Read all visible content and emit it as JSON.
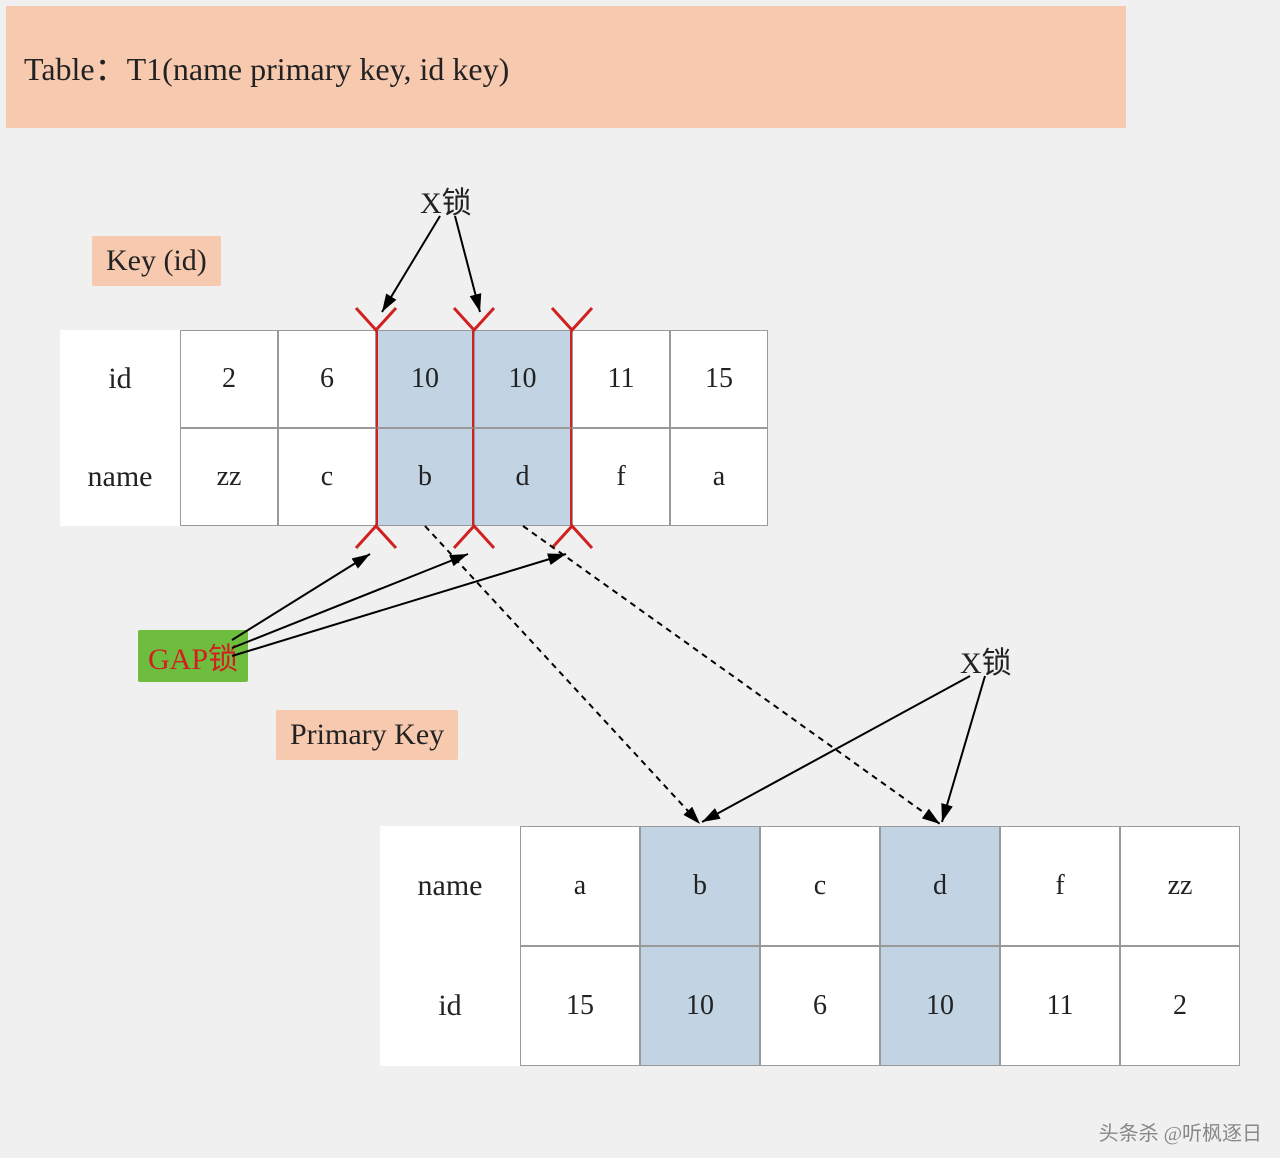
{
  "header": {
    "title": "Table：T1(name primary key, id key)"
  },
  "labels": {
    "key_id": "Key (id)",
    "primary_key": "Primary Key",
    "gap_lock": "GAP锁",
    "x_lock_top": "X锁",
    "x_lock_bottom": "X锁"
  },
  "table_key": {
    "row1_label": "id",
    "row2_label": "name",
    "ids": [
      "2",
      "6",
      "10",
      "10",
      "11",
      "15"
    ],
    "names": [
      "zz",
      "c",
      "b",
      "d",
      "f",
      "a"
    ],
    "highlight_cols": [
      2,
      3
    ]
  },
  "table_pk": {
    "row1_label": "name",
    "row2_label": "id",
    "names": [
      "a",
      "b",
      "c",
      "d",
      "f",
      "zz"
    ],
    "ids": [
      "15",
      "10",
      "6",
      "10",
      "11",
      "2"
    ],
    "highlight_cols": [
      1,
      3
    ]
  },
  "watermark": "头条杀 @听枫逐日"
}
